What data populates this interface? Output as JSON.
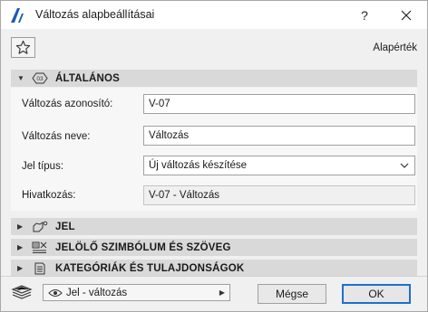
{
  "window": {
    "title": "Változás alapbeállításai",
    "help_label": "?",
    "close_label": "✕"
  },
  "toolbar": {
    "favorites_icon": "star-icon",
    "default_label": "Alapérték"
  },
  "sections": {
    "general": {
      "title": "ÁLTALÁNOS",
      "icon_text": "03",
      "expanded": true
    },
    "marker": {
      "title": "JEL",
      "expanded": false
    },
    "marker_symbol": {
      "title": "JELÖLŐ SZIMBÓLUM ÉS SZÖVEG",
      "expanded": false
    },
    "categories": {
      "title": "KATEGÓRIÁK ÉS TULAJDONSÁGOK",
      "expanded": false
    }
  },
  "form": {
    "id_label": "Változás azonosító:",
    "id_value": "V-07",
    "name_label": "Változás neve:",
    "name_value": "Változás",
    "marker_type_label": "Jel típus:",
    "marker_type_value": "Új változás készítése",
    "reference_label": "Hivatkozás:",
    "reference_value": "V-07 - Változás"
  },
  "footer": {
    "view_combo_value": "Jel - változás",
    "cancel_label": "Mégse",
    "ok_label": "OK"
  },
  "colors": {
    "accent": "#1e6fd0",
    "section_bg": "#d9d9d9",
    "app_icon": "#1b5cb3"
  }
}
